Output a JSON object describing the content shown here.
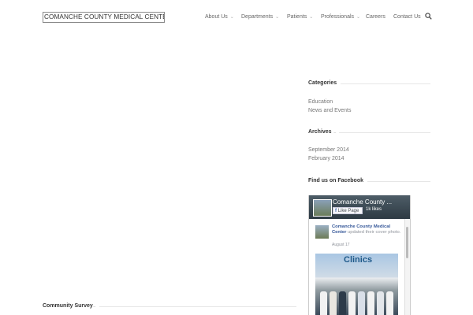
{
  "header": {
    "logo_text": "COMANCHE COUNTY MEDICAL CENTER",
    "nav": [
      {
        "label": "About Us",
        "dropdown": true
      },
      {
        "label": "Departments",
        "dropdown": true
      },
      {
        "label": "Patients",
        "dropdown": true
      },
      {
        "label": "Professionals",
        "dropdown": true
      },
      {
        "label": "Careers",
        "dropdown": false
      },
      {
        "label": "Contact Us",
        "dropdown": false
      }
    ],
    "search_icon": "search-icon"
  },
  "sidebar": {
    "categories": {
      "title": "Categories",
      "items": [
        "Education",
        "News and Events"
      ]
    },
    "archives": {
      "title": "Archives",
      "items": [
        "September 2014",
        "February 2014"
      ]
    },
    "facebook": {
      "title": "Find us on Facebook",
      "page_name": "Comanche County ...",
      "like_label": "Like Page",
      "likes": "1k likes",
      "post_author": "Comanche County Medical Center",
      "post_action": "updated their cover photo.",
      "post_date": "August 17",
      "photo_sign": "Clinics"
    }
  },
  "main": {
    "survey_title": "Community Survey"
  },
  "colors": {
    "link": "#365899",
    "heading": "#333333",
    "text": "#777777"
  }
}
